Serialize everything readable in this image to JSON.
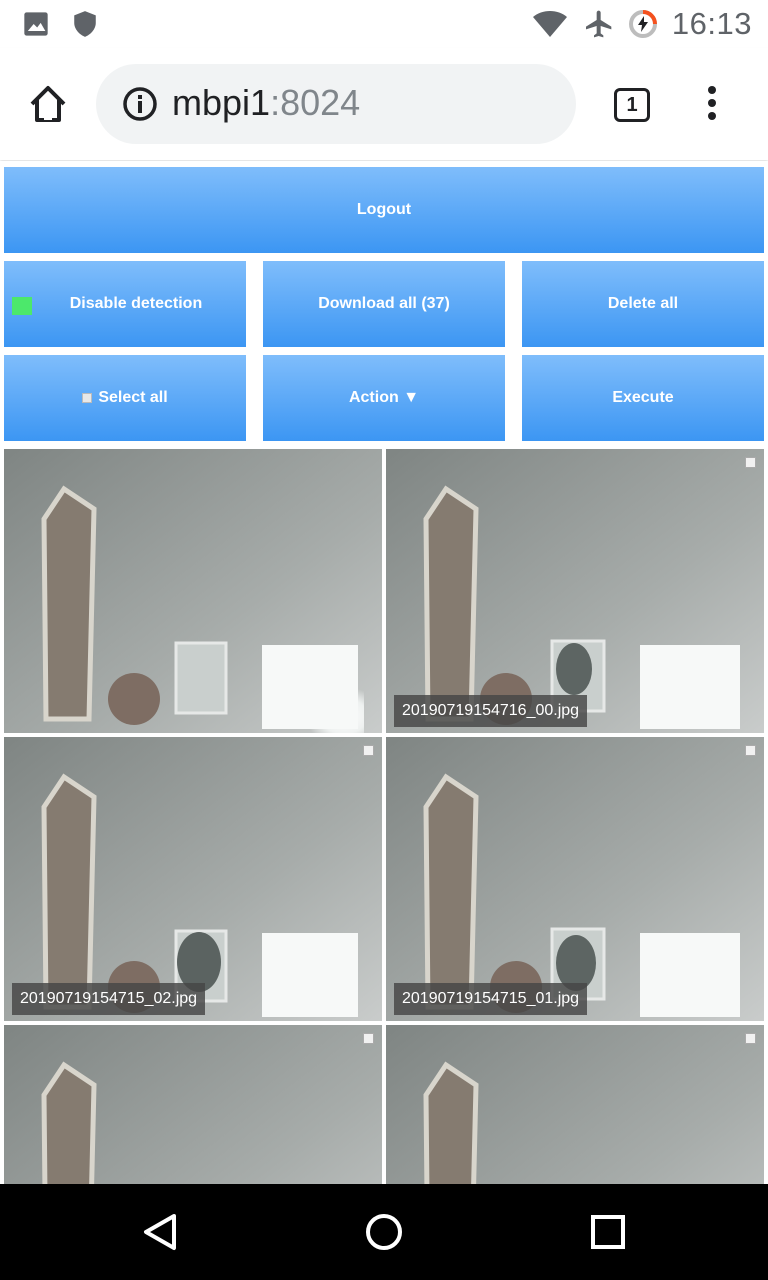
{
  "status_bar": {
    "time": "16:13",
    "icons": [
      "image-icon",
      "shield-icon",
      "wifi-icon",
      "airplane-icon",
      "battery-charging-icon"
    ]
  },
  "browser": {
    "url_host": "mbpi1",
    "url_port": ":8024",
    "tab_count": "1"
  },
  "controls": {
    "logout_label": "Logout",
    "disable_detection_label": "Disable detection",
    "download_all_label": "Download all (37)",
    "delete_all_label": "Delete all",
    "select_all_label": "Select all",
    "action_label": "Action ▼",
    "execute_label": "Execute",
    "detection_indicator_color": "#4ce86b"
  },
  "images": [
    {
      "caption": ""
    },
    {
      "caption": "20190719154716_00.jpg"
    },
    {
      "caption": "20190719154715_02.jpg"
    },
    {
      "caption": "20190719154715_01.jpg"
    },
    {
      "caption": ""
    },
    {
      "caption": ""
    }
  ],
  "nav": {
    "icons": [
      "back-icon",
      "home-circle-icon",
      "recents-icon"
    ]
  }
}
